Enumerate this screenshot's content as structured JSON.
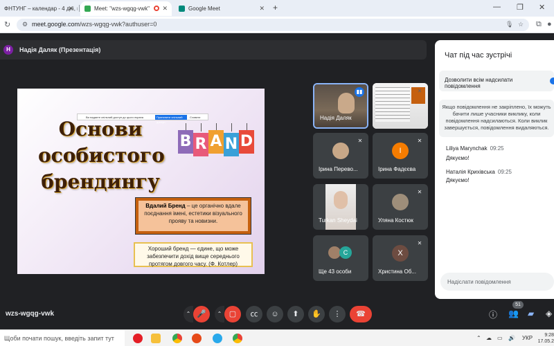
{
  "browser": {
    "tabs": [
      {
        "title": "ФНТУНГ – календар - 4 дні, п"
      },
      {
        "title": "Meet: \"wzs-wgqg-vwk\""
      },
      {
        "title": "Google Meet"
      }
    ],
    "new_tab": "+",
    "address": {
      "host": "meet.google.com",
      "path": "/wzs-wgqg-vwk?authuser=0"
    }
  },
  "presenter_bar": {
    "avatar_letter": "Н",
    "label": "Надія Даляк (Презентація)"
  },
  "slide": {
    "share_notice": "Ви надаєте спільний доступ до цього екрана",
    "share_stop": "Припинити спільний доступ",
    "share_hide": "Сховати",
    "title_lines": [
      "Основи",
      "особистого",
      "брендингу"
    ],
    "brand_letters": [
      "B",
      "R",
      "A",
      "N",
      "D"
    ],
    "box1_bold": "Вдалий Бренд",
    "box1_text": " – це органічно вдале поєднання імені, естетики візуального прояву та новизни.",
    "box2_text": "Хороший бренд — єдине, що може забезпечити дохід вище середнього протягом довгого часу. (Ф. Котлер)"
  },
  "tiles": [
    {
      "name": "Надія Даляк"
    },
    {
      "name": ""
    },
    {
      "name": "Ірина Перево..."
    },
    {
      "name": "Ірина Фадєєва",
      "avatar": "І"
    },
    {
      "name": "Turkan Sheydai"
    },
    {
      "name": "Уляна Костюк"
    },
    {
      "name": "Ще 43 особи",
      "avatar": "С"
    },
    {
      "name": "Христина Об...",
      "avatar": "Х"
    }
  ],
  "meeting_code": "wzs-wgqg-vwk",
  "participant_count": "51",
  "chat": {
    "title": "Чат під час зустрічі",
    "allow_label": "Дозволити всім надсилати повідомлення",
    "notice": "Якщо повідомлення не закріплено, їх можуть бачити лише учасники виклику, коли повідомлення надсилаються. Коли виклик завершується, повідомлення видаляються.",
    "messages": [
      {
        "author": "Liliya Marynchak",
        "time": "09:25",
        "text": "Дякуємо!"
      },
      {
        "author": "Наталія Крихівська",
        "time": "09:25",
        "text": "Дякуємо!"
      }
    ],
    "input_placeholder": "Надіслати повідомлення"
  },
  "taskbar": {
    "search_placeholder": "Щоби почати пошук, введіть запит тут",
    "lang": "УКР",
    "time": "9:28",
    "date": "17.05.2"
  },
  "colors": {
    "end_call": "#ea4335",
    "accent": "#1a73e8",
    "meet_bg": "#202124"
  }
}
